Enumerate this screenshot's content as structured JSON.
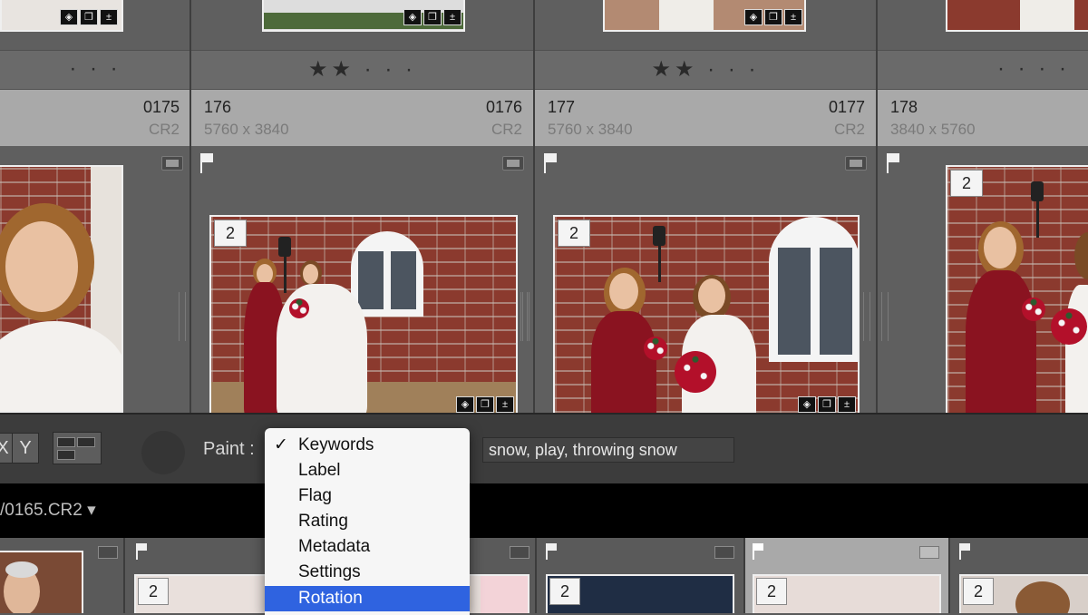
{
  "grid": {
    "cells": [
      {
        "id": "c0",
        "index_number": "",
        "dims": "",
        "file_index": "0175",
        "file_ext": "CR2",
        "stars": "· · ·"
      },
      {
        "id": "c1",
        "index_number": "176",
        "dims": "5760 x 3840",
        "file_index": "0176",
        "file_ext": "CR2",
        "stars": "★★ · · ·",
        "stack_count": "2"
      },
      {
        "id": "c2",
        "index_number": "177",
        "dims": "5760 x 3840",
        "file_index": "0177",
        "file_ext": "CR2",
        "stars": "★★ · · ·",
        "stack_count": "2"
      },
      {
        "id": "c3",
        "index_number": "178",
        "dims": "3840 x 5760",
        "file_index": "",
        "file_ext": "",
        "stars": "· · · ·",
        "stack_count": "2"
      }
    ]
  },
  "toolbar": {
    "x_label": "X",
    "y_label": "Y",
    "paint_label": "Paint :",
    "keywords_value": "snow, play, throwing snow"
  },
  "filename_bar": {
    "filename": "/0165.CR2 ▾"
  },
  "filmstrip": {
    "stack_counts": [
      "2",
      "2",
      "2",
      "2"
    ]
  },
  "paint_menu": {
    "check": "✓",
    "items": [
      "Keywords",
      "Label",
      "Flag",
      "Rating",
      "Metadata",
      "Settings",
      "Rotation"
    ],
    "checked": "Keywords",
    "highlighted": "Rotation"
  },
  "colors": {
    "menu_highlight": "#2f63e0",
    "info_bar": "#a9a9a9",
    "dress_red": "#8a1320"
  }
}
